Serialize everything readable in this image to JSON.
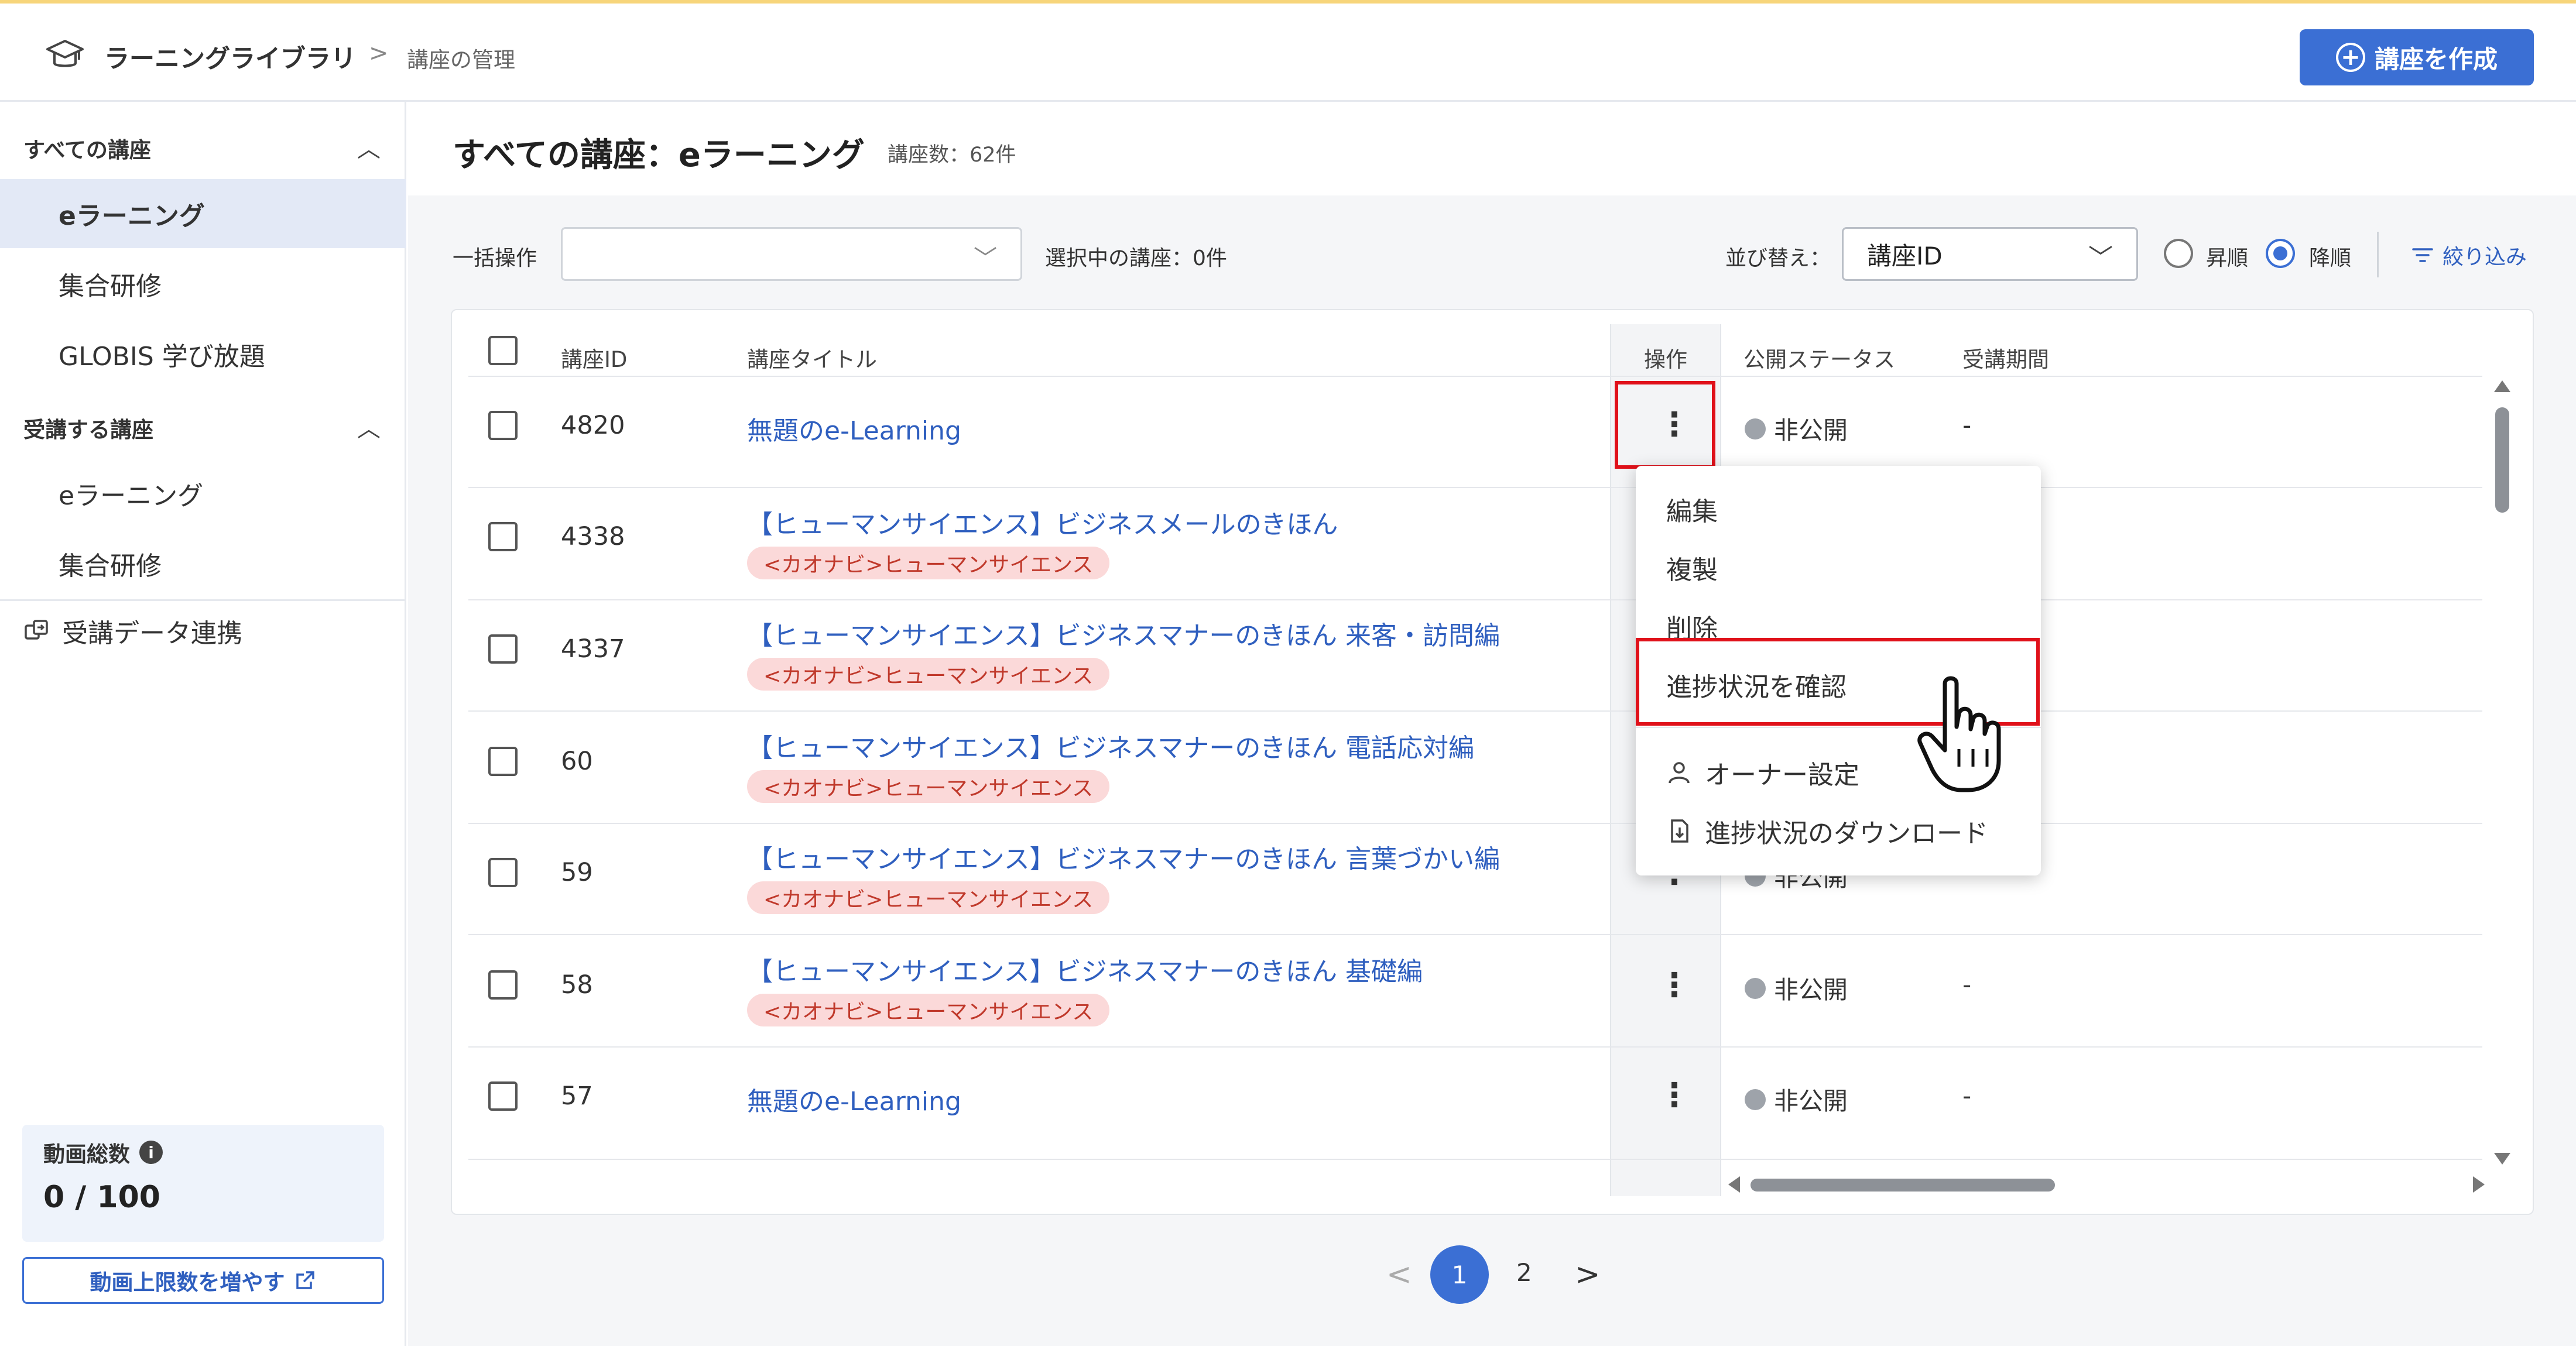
{
  "header": {
    "app_title": "ラーニングライブラリ",
    "breadcrumb_sep": ">",
    "breadcrumb_current": "講座の管理",
    "create_button": "講座を作成",
    "icons": {
      "app": "graduation-cap-icon",
      "create": "plus-circle-icon"
    }
  },
  "sidebar": {
    "group1": {
      "label": "すべての講座",
      "caret": "^"
    },
    "group1_items": [
      "eラーニング",
      "集合研修",
      "GLOBIS 学び放題"
    ],
    "group2": {
      "label": "受講する講座",
      "caret": "^"
    },
    "group2_items": [
      "eラーニング",
      "集合研修"
    ],
    "link": "受講データ連携",
    "quota_label": "動画総数",
    "quota_info": "i",
    "quota_value": "0 / 100",
    "increase_button": "動画上限数を増やす",
    "active_item": "eラーニング",
    "icons": {
      "link": "data-link-icon",
      "info": "info-icon",
      "increase": "external-link-icon"
    }
  },
  "main": {
    "title": "すべての講座：eラーニング",
    "count": "講座数：62件",
    "bulk_label": "一括操作",
    "bulk_value": "",
    "selected_count": "選択中の講座：0件",
    "sort_label": "並び替え：",
    "sort_value": "講座ID",
    "order_asc": "昇順",
    "order_desc": "降順",
    "order_selected": "降順",
    "filter": "絞り込み"
  },
  "table": {
    "headers": {
      "id": "講座ID",
      "title": "講座タイトル",
      "op": "操作",
      "status": "公開ステータス",
      "period": "受講期間"
    },
    "rows": [
      {
        "id": "4820",
        "title": "無題のe-Learning",
        "tag": "",
        "status": "非公開",
        "period": "-"
      },
      {
        "id": "4338",
        "title": "【ヒューマンサイエンス】ビジネスメールのきほん",
        "tag": "<カオナビ>ヒューマンサイエンス",
        "status": "",
        "period": ""
      },
      {
        "id": "4337",
        "title": "【ヒューマンサイエンス】ビジネスマナーのきほん 来客・訪問編",
        "tag": "<カオナビ>ヒューマンサイエンス",
        "status": "",
        "period": ""
      },
      {
        "id": "60",
        "title": "【ヒューマンサイエンス】ビジネスマナーのきほん 電話応対編",
        "tag": "<カオナビ>ヒューマンサイエンス",
        "status": "",
        "period": ""
      },
      {
        "id": "59",
        "title": "【ヒューマンサイエンス】ビジネスマナーのきほん 言葉づかい編",
        "tag": "<カオナビ>ヒューマンサイエンス",
        "status": "非公開",
        "period": "-"
      },
      {
        "id": "58",
        "title": "【ヒューマンサイエンス】ビジネスマナーのきほん 基礎編",
        "tag": "<カオナビ>ヒューマンサイエンス",
        "status": "非公開",
        "period": "-"
      },
      {
        "id": "57",
        "title": "無題のe-Learning",
        "tag": "",
        "status": "非公開",
        "period": "-"
      }
    ],
    "kebab": "⋮"
  },
  "menu": {
    "items": [
      "編集",
      "複製",
      "削除",
      "進捗状況を確認"
    ],
    "extra_items": [
      "オーナー設定",
      "進捗状況のダウンロード"
    ],
    "highlighted": "進捗状況を確認",
    "icons": {
      "owner": "user-icon",
      "download": "download-file-icon",
      "cursor": "hand-pointer-icon"
    }
  },
  "pagination": {
    "prev": "<",
    "current": "1",
    "pages": [
      "1",
      "2"
    ],
    "next": ">"
  },
  "colors": {
    "accent": "#3b6fd4",
    "highlight_box": "#e0111a",
    "tag_bg": "#fbd9d9",
    "tag_text": "#c0392b",
    "active_nav_bg": "#e3e9f6",
    "top_line": "#f7d57a"
  }
}
